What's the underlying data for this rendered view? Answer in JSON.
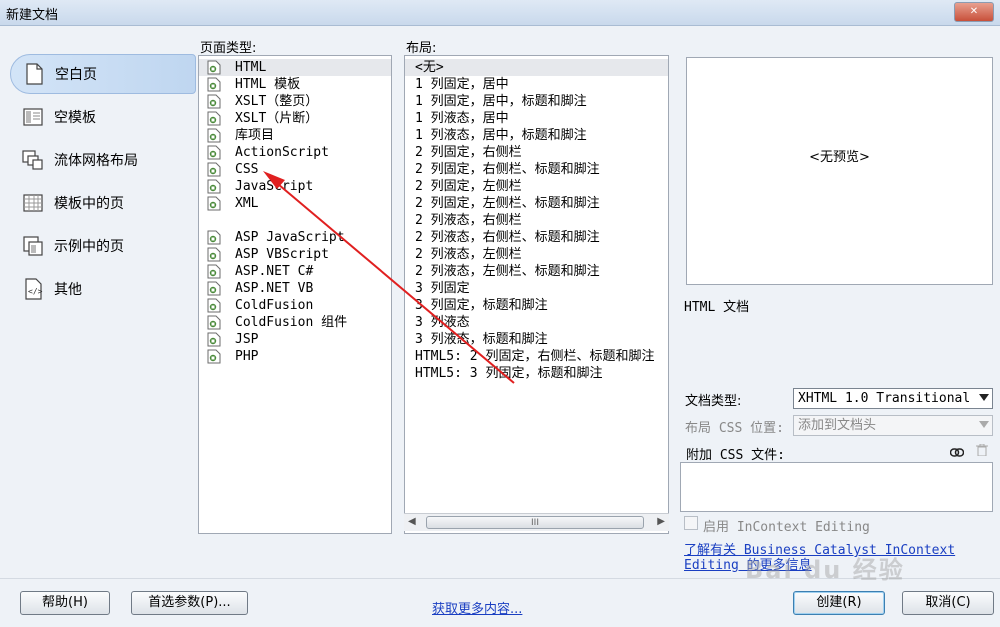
{
  "window": {
    "title": "新建文档"
  },
  "sidebar": {
    "items": [
      {
        "label": "空白页",
        "selected": true,
        "icon": "blank-page-icon"
      },
      {
        "label": "空模板",
        "selected": false,
        "icon": "blank-template-icon"
      },
      {
        "label": "流体网格布局",
        "selected": false,
        "icon": "fluid-grid-icon"
      },
      {
        "label": "模板中的页",
        "selected": false,
        "icon": "template-page-icon"
      },
      {
        "label": "示例中的页",
        "selected": false,
        "icon": "sample-page-icon"
      },
      {
        "label": "其他",
        "selected": false,
        "icon": "other-icon"
      }
    ]
  },
  "page_type": {
    "label": "页面类型:",
    "group1": [
      "HTML",
      "HTML 模板",
      "XSLT（整页）",
      "XSLT（片断）",
      "库项目",
      "ActionScript",
      "CSS",
      "JavaScript",
      "XML"
    ],
    "group2": [
      "ASP JavaScript",
      "ASP VBScript",
      "ASP.NET C#",
      "ASP.NET VB",
      "ColdFusion",
      "ColdFusion 组件",
      "JSP",
      "PHP"
    ],
    "selected": "HTML"
  },
  "layout": {
    "label": "布局:",
    "items": [
      "<无>",
      "1 列固定，居中",
      "1 列固定，居中，标题和脚注",
      "1 列液态，居中",
      "1 列液态，居中，标题和脚注",
      "2 列固定，右侧栏",
      "2 列固定，右侧栏、标题和脚注",
      "2 列固定，左侧栏",
      "2 列固定，左侧栏、标题和脚注",
      "2 列液态，右侧栏",
      "2 列液态，右侧栏、标题和脚注",
      "2 列液态，左侧栏",
      "2 列液态，左侧栏、标题和脚注",
      "3 列固定",
      "3 列固定，标题和脚注",
      "3 列液态",
      "3 列液态，标题和脚注",
      "HTML5: 2 列固定，右侧栏、标题和脚注",
      "HTML5: 3 列固定，标题和脚注"
    ],
    "selected": "<无>",
    "scroll_thumb": "III"
  },
  "preview": {
    "text": "<无预览>",
    "description": "HTML 文档"
  },
  "form": {
    "doctype_label": "文档类型:",
    "doctype_value": "XHTML 1.0 Transitional",
    "layout_css_label": "布局 CSS 位置:",
    "layout_css_value": "添加到文档头",
    "attach_css_label": "附加 CSS 文件:",
    "incontext_label": "启用 InContext Editing",
    "bc_link": "了解有关 Business Catalyst InContext Editing 的更多信息"
  },
  "buttons": {
    "help": "帮助(H)",
    "prefs": "首选参数(P)...",
    "more": "获取更多内容...",
    "create": "创建(R)",
    "cancel": "取消(C)"
  },
  "annotation": {
    "color": "#e02020"
  },
  "watermark": "Bai du 经验"
}
